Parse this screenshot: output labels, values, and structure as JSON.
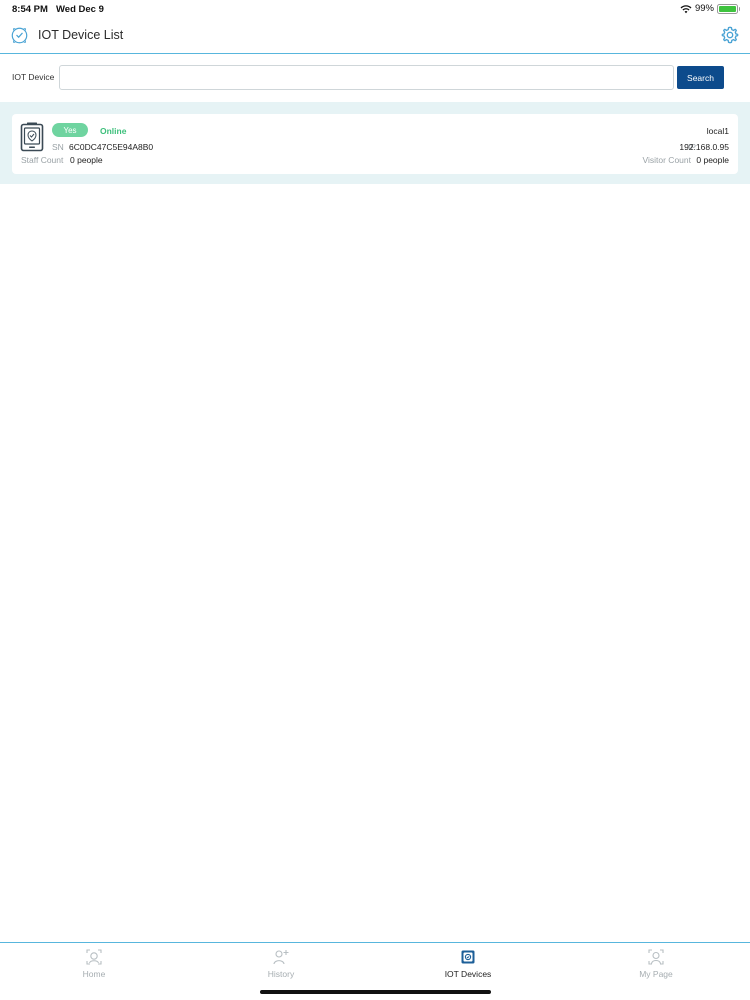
{
  "status_bar": {
    "time": "8:54 PM",
    "date": "Wed Dec 9",
    "battery": "99%",
    "battery_level": 0.99,
    "wifi_icon": "wifi-icon",
    "battery_icon": "battery-icon"
  },
  "header": {
    "title": "IOT Device List",
    "logo_icon": "face-shield-logo-icon",
    "settings_icon": "gear-icon"
  },
  "search": {
    "label": "IOT Device",
    "value": "",
    "placeholder": "",
    "button_label": "Search"
  },
  "devices": [
    {
      "badge": "Yes",
      "status": "Online",
      "name": "local1",
      "sn_label": "SN",
      "sn": "6C0DC47C5E94A8B0",
      "ip_label": "IP",
      "ip": "192.168.0.95",
      "staff_label": "Staff Count",
      "staff_count": "0 people",
      "visitor_label": "Visitor Count",
      "visitor_count": "0 people",
      "icon": "device-terminal-icon"
    }
  ],
  "tab_bar": {
    "tabs": [
      {
        "label": "Home",
        "icon": "face-scan-icon",
        "active": false
      },
      {
        "label": "History",
        "icon": "history-person-icon",
        "active": false
      },
      {
        "label": "IOT Devices",
        "icon": "iot-device-icon",
        "active": true
      },
      {
        "label": "My Page",
        "icon": "user-profile-icon",
        "active": false
      }
    ]
  },
  "colors": {
    "accent": "#58b6dd",
    "search_button": "#0d4b8c",
    "online": "#3bbf7a",
    "badge": "#6fd4a0",
    "list_background": "#e6f3f5"
  }
}
